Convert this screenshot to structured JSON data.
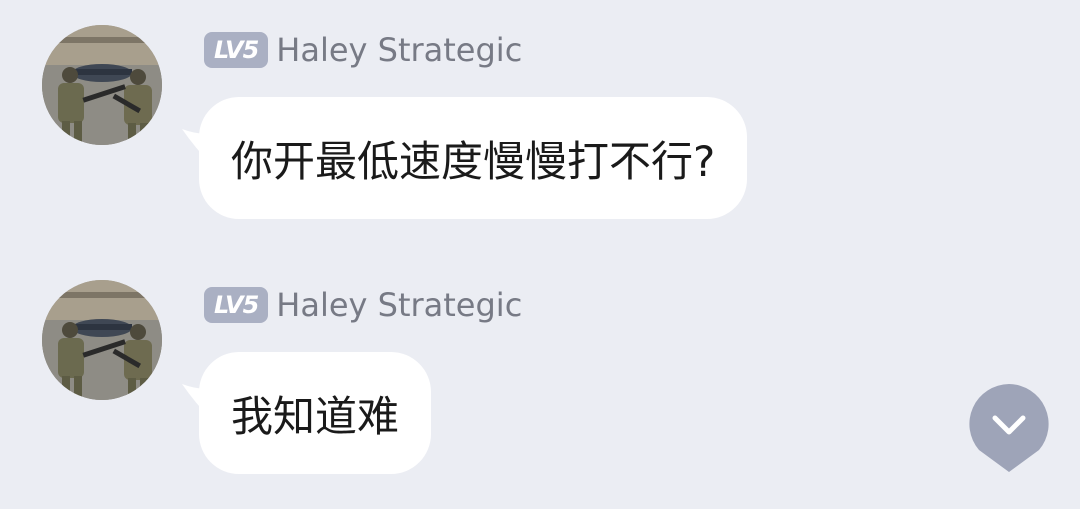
{
  "messages": [
    {
      "level": "LV5",
      "sender": "Haley Strategic",
      "text": "你开最低速度慢慢打不行?"
    },
    {
      "level": "LV5",
      "sender": "Haley Strategic",
      "text": "我知道难"
    }
  ],
  "icons": {
    "scroll_down": "chevron-down-icon",
    "avatar": "soldiers-photo-avatar"
  },
  "colors": {
    "background": "#ebedf3",
    "bubble": "#ffffff",
    "level_badge": "#aab0c3",
    "sender_name": "#777a85",
    "scroll_button": "#9ea4b8"
  }
}
